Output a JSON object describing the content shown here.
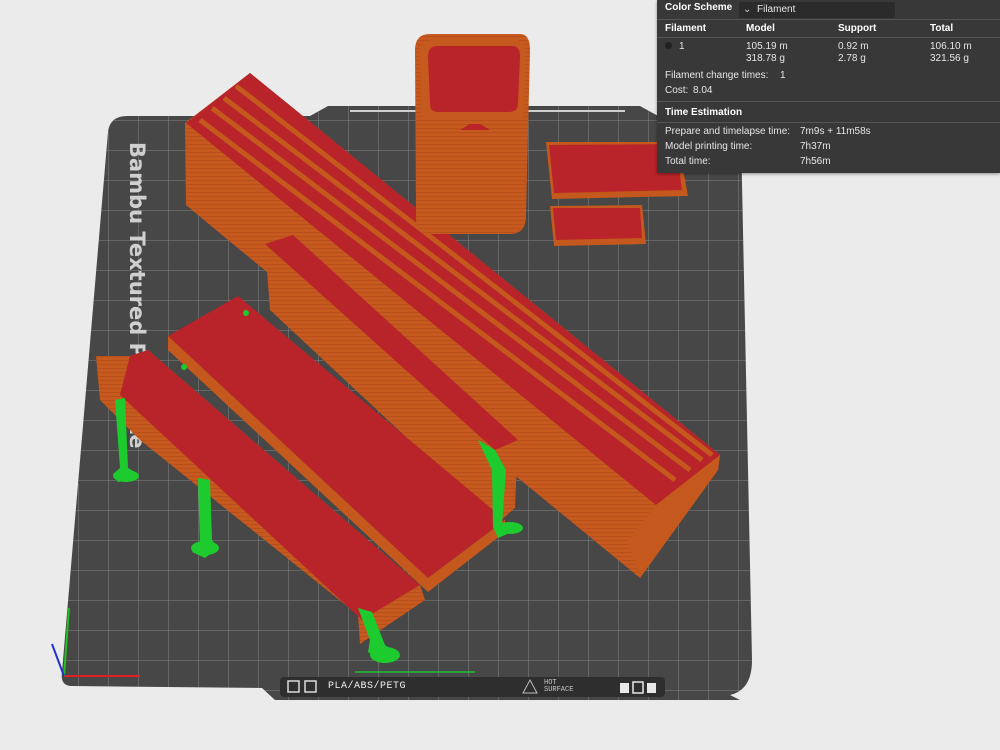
{
  "bed": {
    "plate_label": "Bambu Textured PEI Plate",
    "bottom_bar": {
      "material_label": "PLA/ABS/PETG",
      "hot_label_1": "HOT",
      "hot_label_2": "SURFACE"
    }
  },
  "stats_panel": {
    "color_scheme_label": "Color Scheme",
    "color_scheme_value": "Filament",
    "headers": [
      "Filament",
      "Model",
      "Support",
      "Total"
    ],
    "filament_row": {
      "id": "1",
      "model_length": "105.19 m",
      "model_weight": "318.78 g",
      "support_length": "0.92 m",
      "support_weight": "2.78 g",
      "total_length": "106.10 m",
      "total_weight": "321.56 g"
    },
    "change_times_label": "Filament change times:",
    "change_times_value": "1",
    "cost_label": "Cost:",
    "cost_value": "8.04",
    "time_title": "Time Estimation",
    "prepare_label": "Prepare and timelapse time:",
    "prepare_value": "7m9s + 11m58s",
    "model_time_label": "Model printing time:",
    "model_time_value": "7h37m",
    "total_time_label": "Total time:",
    "total_time_value": "7h56m"
  },
  "colors": {
    "bed": "#474747",
    "grid": "#8a8a8a",
    "part_side": "#c4581d",
    "part_top": "#b8242a",
    "support": "#1ecb2e",
    "panel_bg": "#383838"
  }
}
